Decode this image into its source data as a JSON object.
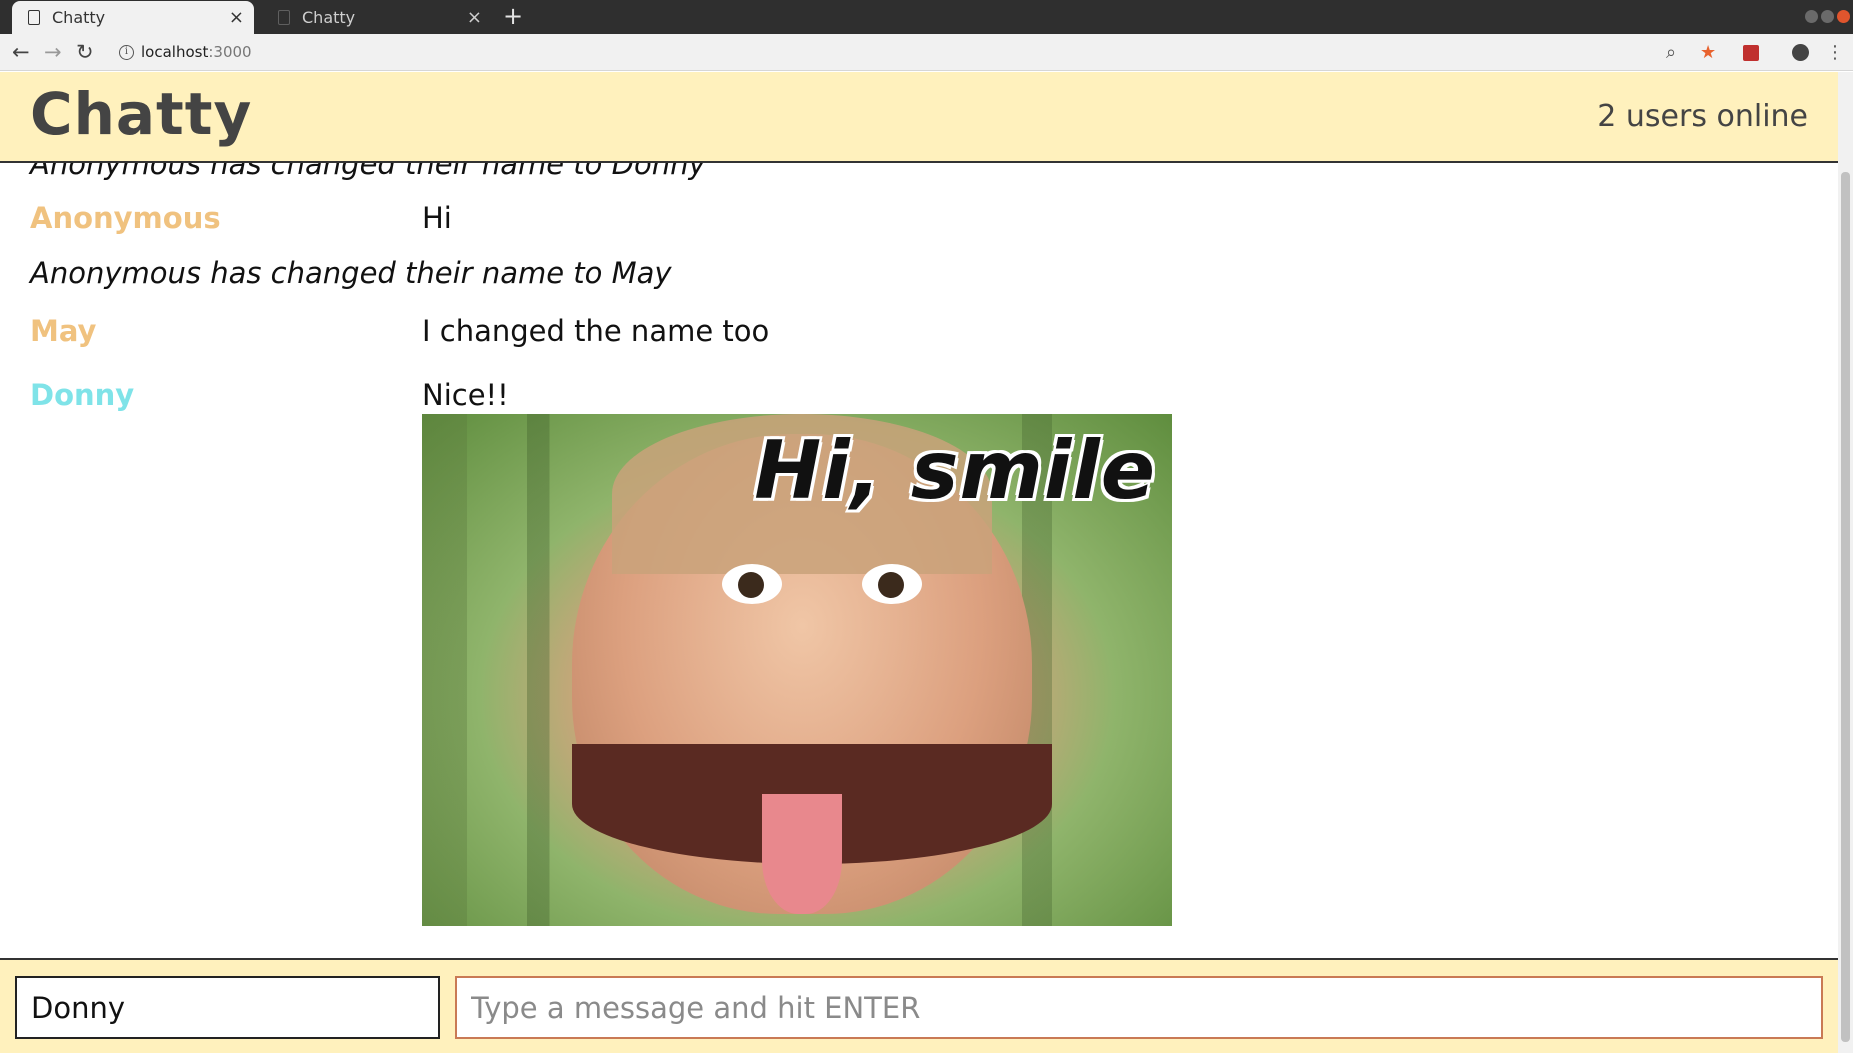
{
  "browser": {
    "tabs": [
      {
        "title": "Chatty",
        "active": true
      },
      {
        "title": "Chatty",
        "active": false
      }
    ],
    "new_tab": "+",
    "tab_close": "×",
    "address": {
      "host": "localhost",
      "port": ":3000"
    }
  },
  "app": {
    "brand": "Chatty",
    "users_online": "2 users online"
  },
  "messages": {
    "notification_top": "Anonymous has changed their name to Donny",
    "items": [
      {
        "username": "Anonymous",
        "content": "Hi",
        "color": "#f0c27f"
      },
      {
        "notification": "Anonymous has changed their name to May"
      },
      {
        "username": "May",
        "content": "I changed the name too",
        "color": "#f0c27f"
      },
      {
        "username": "Donny",
        "content": "Nice!!",
        "color": "#7fe3e8",
        "image_caption": "Hi, smile"
      }
    ]
  },
  "composer": {
    "username_value": "Donny",
    "message_placeholder": "Type a message and hit ENTER"
  },
  "colors": {
    "navbar_bg": "#fff1bd",
    "text_dark": "#444444"
  }
}
